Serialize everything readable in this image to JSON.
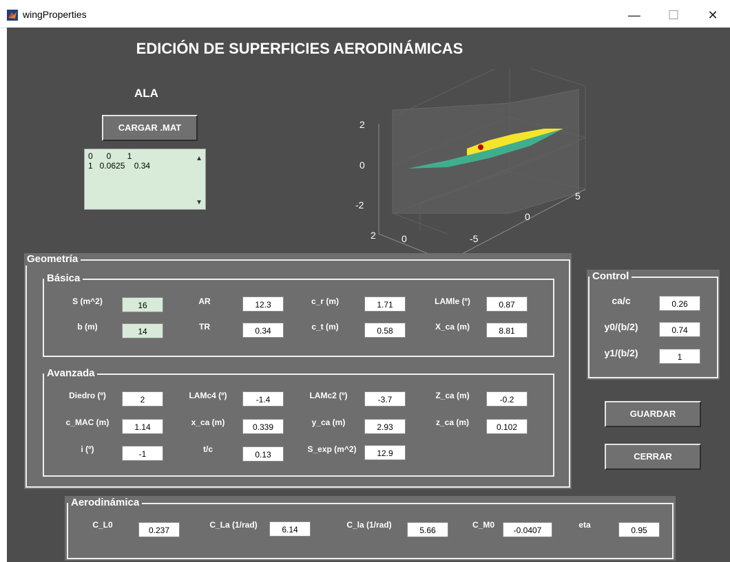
{
  "window": {
    "title": "wingProperties",
    "minimize": "—",
    "maximize": "☐",
    "close": "✕"
  },
  "main_title": "EDICIÓN DE SUPERFICIES AERODINÁMICAS",
  "wing_label": "ALA",
  "load_button": "CARGAR .MAT",
  "listbox": {
    "rows": [
      "0      0       1",
      "1   0.0625    0.34"
    ],
    "up": "▲",
    "down": "▼"
  },
  "plot": {
    "z_ticks": [
      "2",
      "0",
      "-2"
    ],
    "x_ticks": [
      "2",
      "0"
    ],
    "y_ticks": [
      "5",
      "0",
      "-5"
    ]
  },
  "geometry": {
    "title": "Geometría",
    "basic": {
      "title": "Básica",
      "S_label": "S (m^2)",
      "S": "16",
      "AR_label": "AR",
      "AR": "12.3",
      "c_r_label": "c_r (m)",
      "c_r": "1.71",
      "LAMle_label": "LAMle (º)",
      "LAMle": "0.87",
      "b_label": "b (m)",
      "b": "14",
      "TR_label": "TR",
      "TR": "0.34",
      "c_t_label": "c_t (m)",
      "c_t": "0.58",
      "X_ca_label": "X_ca (m)",
      "X_ca": "8.81"
    },
    "advanced": {
      "title": "Avanzada",
      "diedro_label": "Diedro (º)",
      "diedro": "2",
      "LAMc4_label": "LAMc4 (º)",
      "LAMc4": "-1.4",
      "LAMc2_label": "LAMc2 (º)",
      "LAMc2": "-3.7",
      "Z_ca_label": "Z_ca (m)",
      "Z_ca": "-0.2",
      "c_MAC_label": "c_MAC (m)",
      "c_MAC": "1.14",
      "x_ca_label": "x_ca (m)",
      "x_ca": "0.339",
      "y_ca_label": "y_ca (m)",
      "y_ca": "2.93",
      "z_ca_label": "z_ca (m)",
      "z_ca": "0.102",
      "i_label": "i (º)",
      "i": "-1",
      "tc_label": "t/c",
      "tc": "0.13",
      "S_exp_label": "S_exp (m^2)",
      "S_exp": "12.9"
    }
  },
  "control": {
    "title": "Control",
    "cac_label": "ca/c",
    "cac": "0.26",
    "y0_label": "y0/(b/2)",
    "y0": "0.74",
    "y1_label": "y1/(b/2)",
    "y1": "1"
  },
  "save_button": "GUARDAR",
  "close_button": "CERRAR",
  "aero": {
    "title": "Aerodinámica",
    "CL0_label": "C_L0",
    "CL0": "0.237",
    "CLa_label": "C_La (1/rad)",
    "CLa": "6.14",
    "Cla_label": "C_la (1/rad)",
    "Cla": "5.66",
    "CM0_label": "C_M0",
    "CM0": "-0.0407",
    "eta_label": "eta",
    "eta": "0.95"
  },
  "colors": {
    "background": "#4d4d4d",
    "panel": "#6e6e6e",
    "green_field": "#d8ead8",
    "wing_yellow": "#f5e52a",
    "wing_green": "#3fae8f",
    "marker": "#c00000"
  }
}
